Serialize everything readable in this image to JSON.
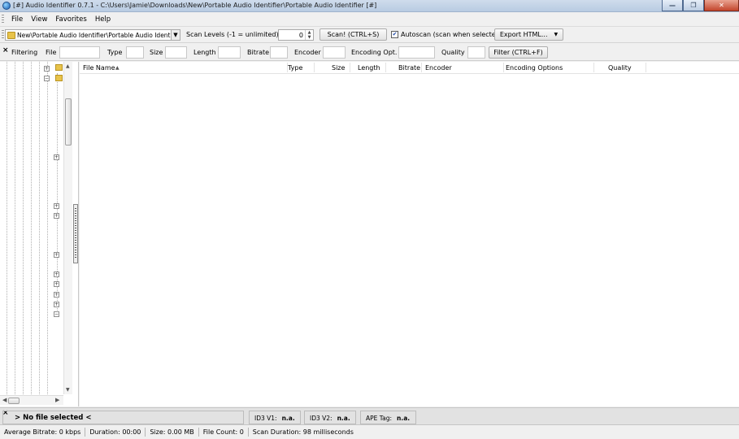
{
  "window": {
    "title": "[#] Audio Identifier 0.7.1 - C:\\Users\\Jamie\\Downloads\\New\\Portable Audio Identifier\\Portable Audio Identifier [#]",
    "minimize_icon": "minimize-icon",
    "maximize_icon": "restore-icon",
    "close_icon": "close-icon"
  },
  "menu": [
    "File",
    "View",
    "Favorites",
    "Help"
  ],
  "toolbar": {
    "path": "New\\Portable Audio Identifier\\Portable Audio Identifier",
    "scan_levels_label": "Scan Levels (-1 = unlimited)",
    "scan_levels_value": "0",
    "scan_button": "Scan! (CTRL+S)",
    "autoscan_label": "Autoscan (scan when selected)",
    "autoscan_checked": true,
    "export_button": "Export HTML..."
  },
  "filter": {
    "close": "×",
    "title": "Filtering",
    "file_label": "File",
    "type_label": "Type",
    "size_label": "Size",
    "length_label": "Length",
    "bitrate_label": "Bitrate",
    "encoder_label": "Encoder",
    "encoding_opt_label": "Encoding Opt.",
    "quality_label": "Quality",
    "filter_button": "Filter (CTRL+F)"
  },
  "columns": [
    "File Name",
    "Type",
    "Size",
    "Length",
    "Bitrate",
    "Encoder",
    "Encoding Options",
    "Quality"
  ],
  "info": {
    "close": "×",
    "no_file": "> No file selected <",
    "id3v1_label": "ID3 V1:",
    "id3v1_value": "n.a.",
    "id3v2_label": "ID3 V2:",
    "id3v2_value": "n.a.",
    "ape_label": "APE Tag:",
    "ape_value": "n.a."
  },
  "status": {
    "avg_bitrate": "Average Bitrate: 0 kbps",
    "duration": "Duration: 00:00",
    "size": "Size: 0.00 MB",
    "file_count": "File Count: 0",
    "scan_duration": "Scan Duration: 98 milliseconds"
  },
  "colors": {
    "folder": "#e8c34a",
    "titlebar": "#c6d6ea",
    "close_button": "#c3452c"
  }
}
